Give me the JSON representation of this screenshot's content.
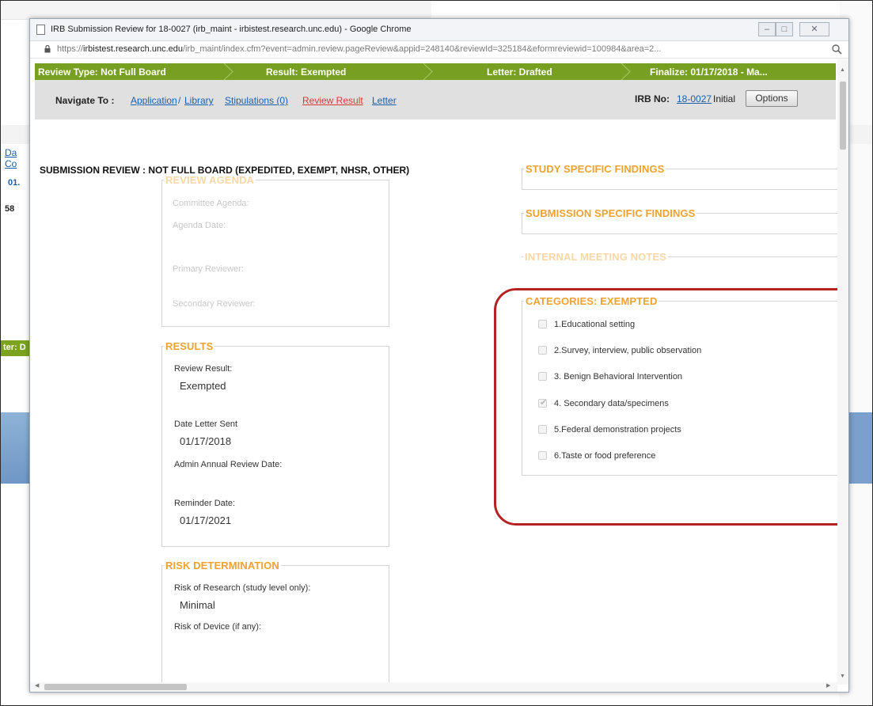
{
  "background": {
    "links": [
      "Da",
      "Co",
      "01."
    ],
    "number": "58",
    "greenbar_text": "ter: D"
  },
  "window": {
    "title": "IRB Submission Review for 18-0027 (irb_maint - irbistest.research.unc.edu) - Google Chrome",
    "controls": {
      "minimize": "–",
      "maximize": "□",
      "close": "✕"
    }
  },
  "address": {
    "scheme": "https://",
    "host": "irbistest.research.unc.edu",
    "path": "/irb_maint/index.cfm?event=admin.review.pageReview&appid=248140&reviewId=325184&eformreviewid=100984&area=2..."
  },
  "review_bar": {
    "review_type": "Review Type: Not Full Board",
    "result": "Result: Exempted",
    "letter": "Letter: Drafted",
    "finalize": "Finalize: 01/17/2018 - Ma..."
  },
  "nav": {
    "label": "Navigate To :",
    "links": {
      "application": "Application",
      "separator": "/",
      "library": "Library",
      "stipulations": "Stipulations (0)",
      "review_result": "Review Result",
      "letter": "Letter"
    },
    "irb_label": "IRB No:",
    "irb_number": "18-0027",
    "status": "Initial",
    "options_button": "Options"
  },
  "page_title": "SUBMISSION REVIEW : NOT FULL BOARD (EXPEDITED, EXEMPT, NHSR, OTHER)",
  "review_agenda": {
    "legend": "REVIEW AGENDA",
    "committee_agenda": "Committee Agenda:",
    "agenda_date": "Agenda Date:",
    "primary_reviewer": "Primary Reviewer:",
    "secondary_reviewer": "Secondary Reviewer:"
  },
  "results": {
    "legend": "RESULTS",
    "review_result_label": "Review Result:",
    "review_result_value": "Exempted",
    "date_letter_sent_label": "Date Letter Sent",
    "date_letter_sent_value": "01/17/2018",
    "admin_annual_review_label": "Admin Annual Review Date:",
    "reminder_date_label": "Reminder Date:",
    "reminder_date_value": "01/17/2021"
  },
  "risk": {
    "legend": "RISK DETERMINATION",
    "risk_research_label": "Risk of Research (study level only):",
    "risk_research_value": "Minimal",
    "risk_device_label": "Risk of Device (if any):"
  },
  "right_sections": {
    "study_findings": "STUDY SPECIFIC FINDINGS",
    "submission_findings": "SUBMISSION SPECIFIC FINDINGS",
    "internal_notes": "INTERNAL MEETING NOTES"
  },
  "categories": {
    "legend": "CATEGORIES: EXEMPTED",
    "items": [
      {
        "label": "1.Educational setting",
        "checked": false
      },
      {
        "label": "2.Survey, interview, public observation",
        "checked": false
      },
      {
        "label": "3. Benign Behavioral Intervention",
        "checked": false
      },
      {
        "label": "4. Secondary data/specimens",
        "checked": true
      },
      {
        "label": "5.Federal demonstration projects",
        "checked": false
      },
      {
        "label": "6.Taste or food preference",
        "checked": false
      }
    ]
  },
  "colors": {
    "green_bar": "#77a022",
    "legend_orange": "#f0a22e",
    "highlight_red": "#b52222",
    "link_blue": "#1a5fa8",
    "link_red": "#d43b32"
  },
  "icons": {
    "page": "page-icon",
    "lock": "lock-icon",
    "zoom": "magnifier-icon"
  }
}
